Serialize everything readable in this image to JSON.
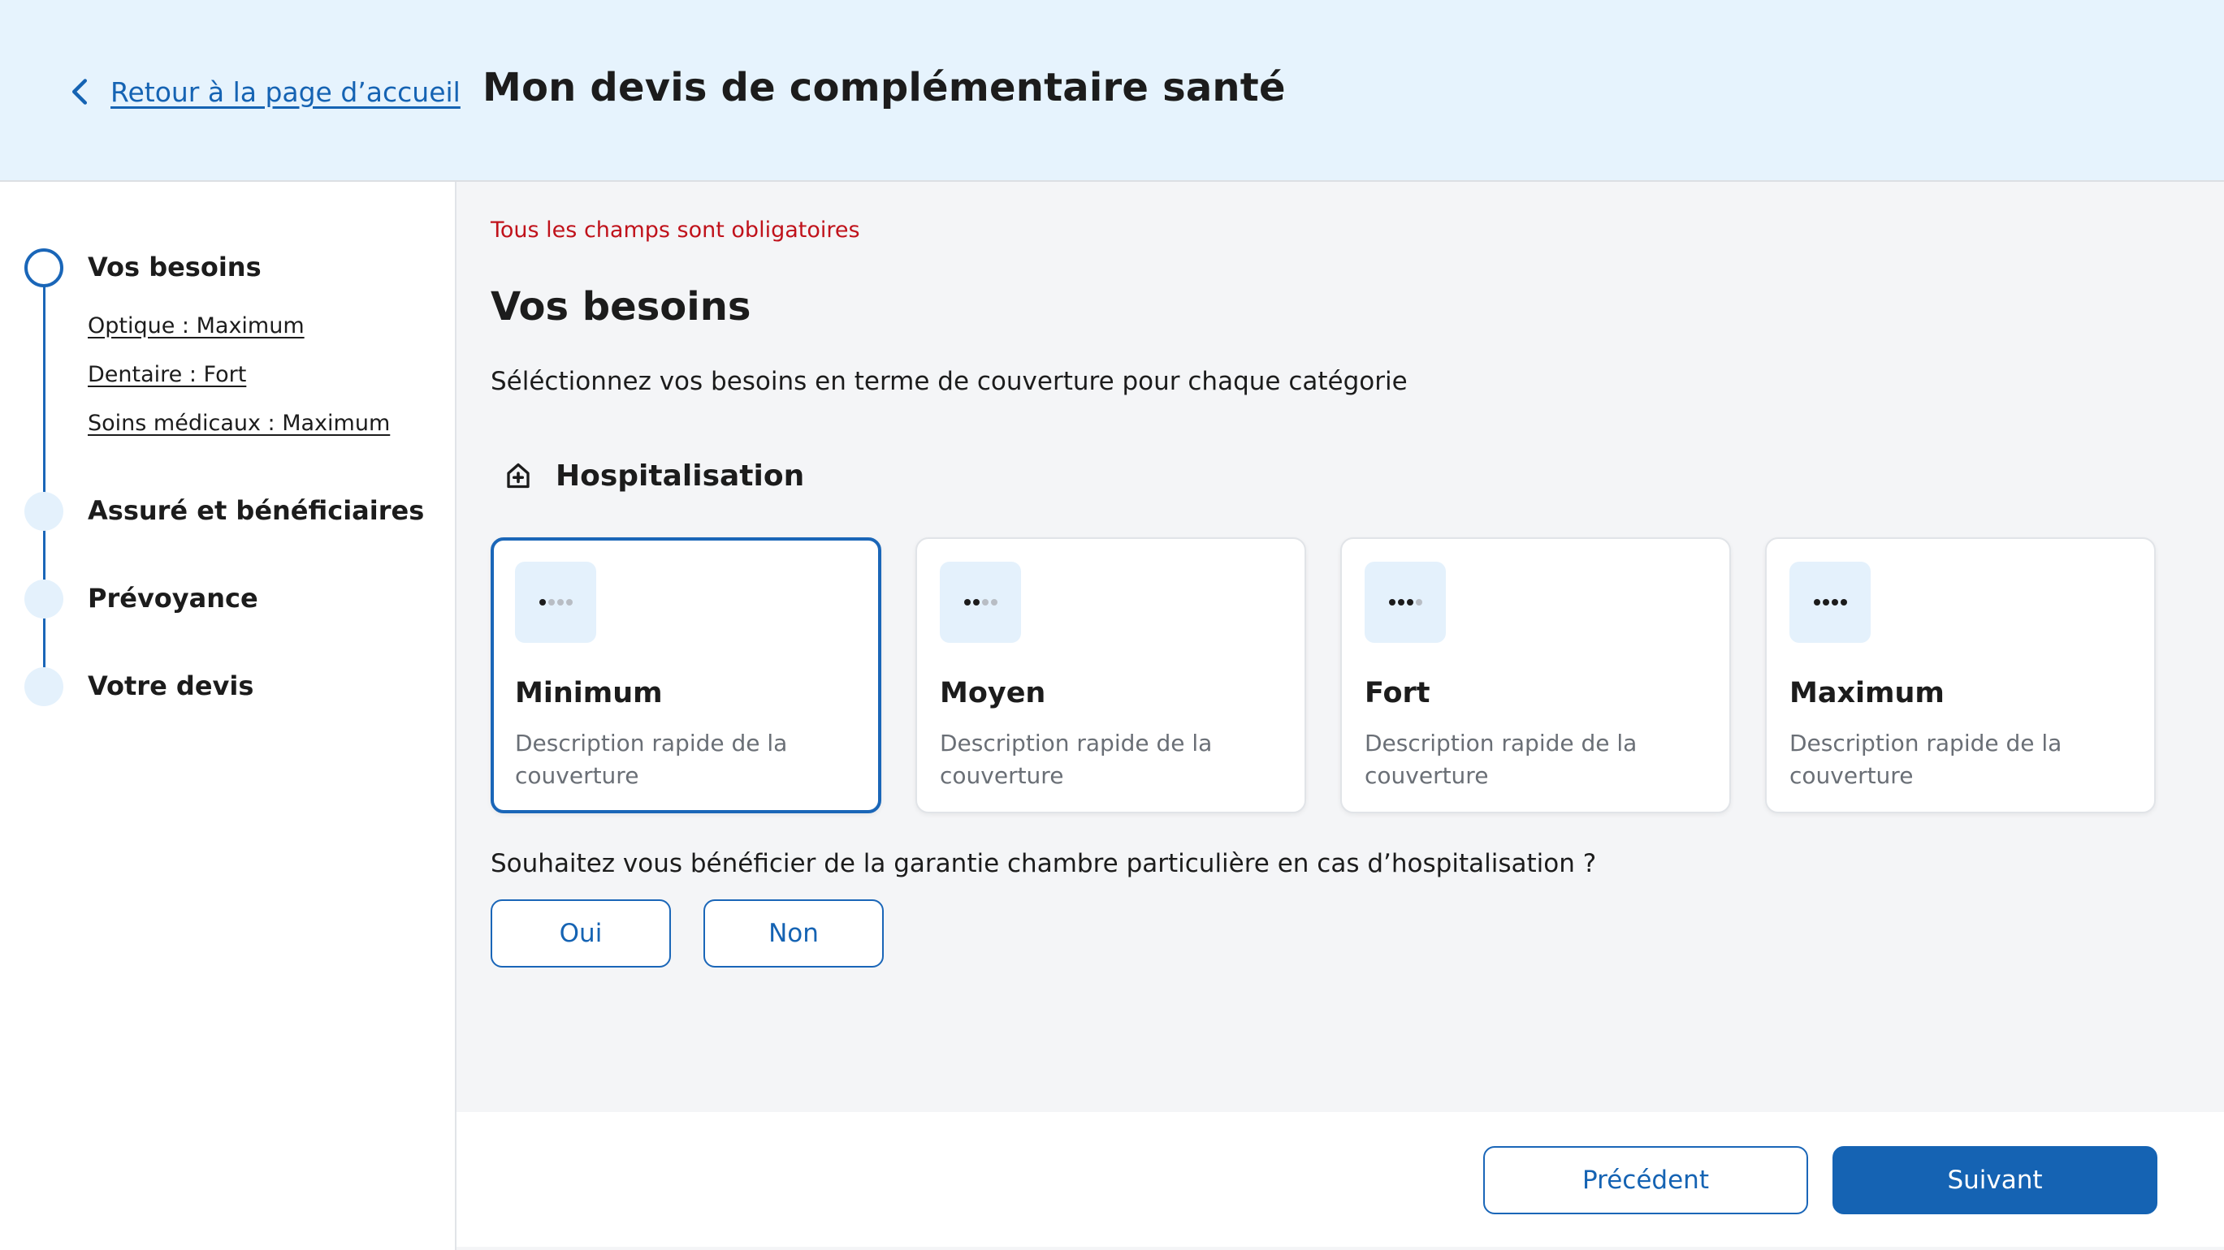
{
  "header": {
    "back_label": "Retour à la page d’accueil",
    "title": "Mon devis de complémentaire santé"
  },
  "sidebar": {
    "steps": [
      {
        "label": "Vos besoins",
        "active": true,
        "substeps": [
          {
            "label": "Optique : Maximum"
          },
          {
            "label": "Dentaire : Fort"
          },
          {
            "label": "Soins médicaux : Maximum"
          }
        ]
      },
      {
        "label": "Assuré et bénéficiaires",
        "active": false
      },
      {
        "label": "Prévoyance",
        "active": false
      },
      {
        "label": "Votre devis",
        "active": false
      }
    ]
  },
  "main": {
    "required_note": "Tous les champs sont obligatoires",
    "title": "Vos besoins",
    "description": "Séléctionnez vos besoins en terme de couverture pour chaque catégorie",
    "category": {
      "icon": "hospital-icon",
      "label": "Hospitalisation"
    },
    "options": [
      {
        "title": "Minimum",
        "description": "Description rapide de la couverture",
        "level": 1,
        "selected": true
      },
      {
        "title": "Moyen",
        "description": "Description rapide de la couverture",
        "level": 2,
        "selected": false
      },
      {
        "title": "Fort",
        "description": "Description rapide de la couverture",
        "level": 3,
        "selected": false
      },
      {
        "title": "Maximum",
        "description": "Description rapide de la couverture",
        "level": 4,
        "selected": false
      }
    ],
    "question": "Souhaitez vous bénéficier de la garantie chambre particulière en cas d’hospitalisation ?",
    "choices": {
      "yes": "Oui",
      "no": "Non"
    }
  },
  "footer": {
    "previous": "Précédent",
    "next": "Suivant"
  },
  "colors": {
    "accent": "#1563b3",
    "header_bg": "#e6f3fd",
    "main_bg": "#f4f5f7",
    "error": "#c0121b"
  }
}
